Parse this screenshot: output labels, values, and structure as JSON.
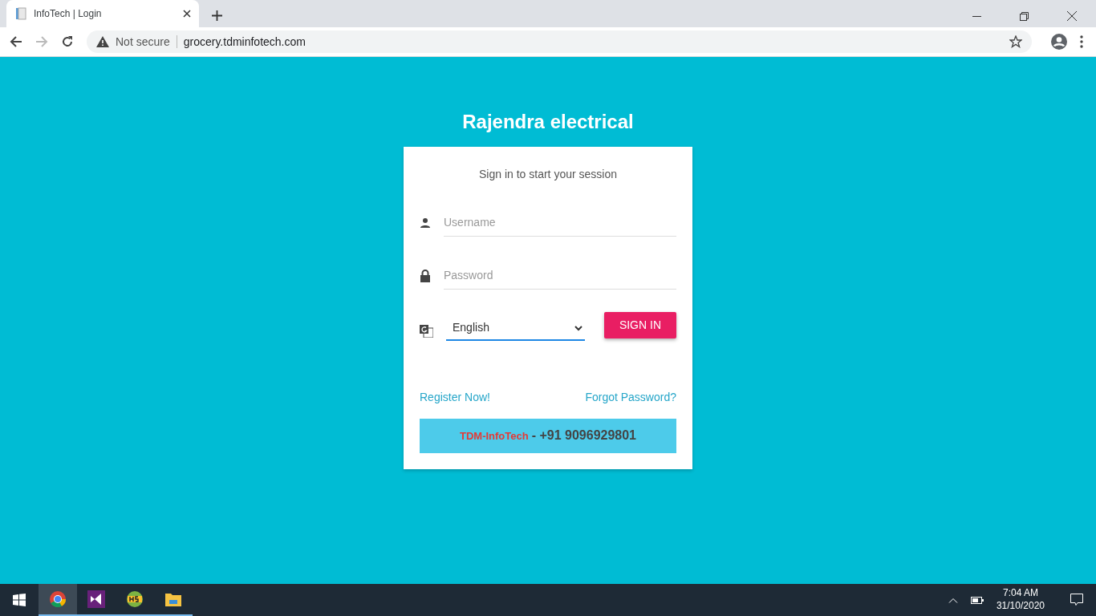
{
  "browser": {
    "tab_title": "InfoTech | Login",
    "security": "Not secure",
    "url": "grocery.tdminfotech.com"
  },
  "login": {
    "heading": "Rajendra electrical",
    "subtitle": "Sign in to start your session",
    "username": {
      "placeholder": "Username"
    },
    "password": {
      "placeholder": "Password"
    },
    "language": {
      "value": "English"
    },
    "sign_in": "SIGN IN",
    "register": "Register Now!",
    "forgot": "Forgot Password?",
    "footer_brand": "TDM-InfoTech",
    "footer_phone": "- +91 9096929801"
  },
  "taskbar": {
    "apps": [
      {
        "kind": "chrome",
        "selected": true
      },
      {
        "kind": "studio",
        "selected": false
      },
      {
        "kind": "hs",
        "selected": false
      },
      {
        "kind": "folder",
        "selected": false
      }
    ],
    "time": "7:04 AM",
    "date": "31/10/2020"
  }
}
